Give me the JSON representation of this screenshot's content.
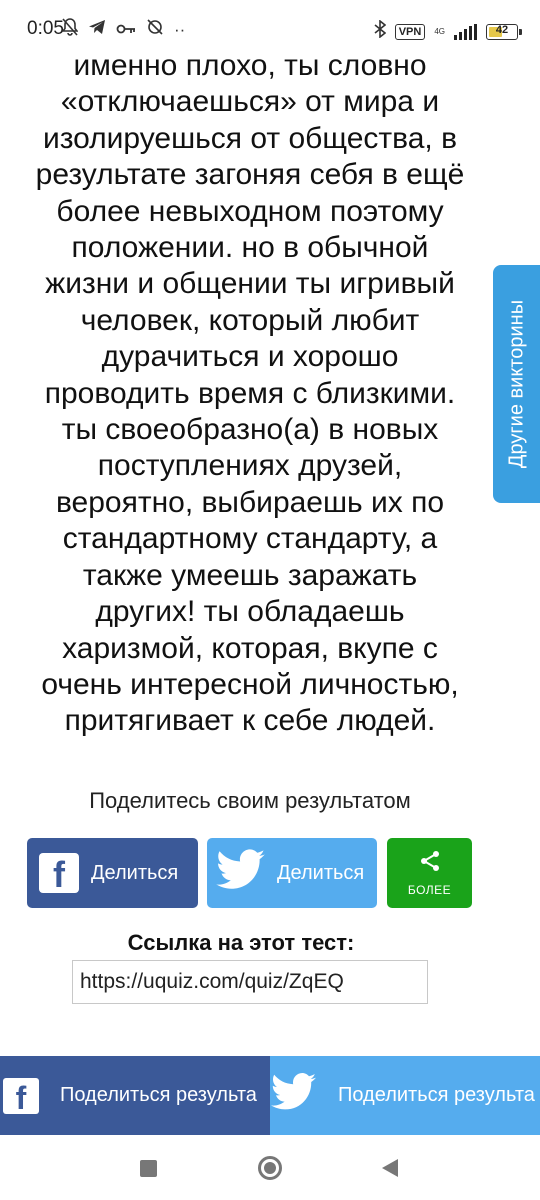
{
  "status_bar": {
    "time": "0:05",
    "vpn": "VPN",
    "network": "4G",
    "battery": "42"
  },
  "result": {
    "lines": [
      "именно плохо, ты словно",
      "«отключаешься» от мира и",
      "изолируешься от общества, в",
      "результате загоняя себя в ещё",
      "более невыходном поэтому",
      "положении. но в обычной",
      "жизни и общении ты игривый",
      "человек, который любит",
      "дурачиться и хорошо",
      "проводить время с близкими.",
      "ты своеобразно(а) в новых",
      "поступлениях друзей,",
      "вероятно, выбираешь их по",
      "стандартному стандарту, а",
      "также умеешь заражать",
      "других! ты обладаешь",
      "харизмой, которая, вкупе с",
      "очень интересной личностью,",
      "притягивает к себе людей."
    ]
  },
  "side_tab": {
    "label": "Другие викторины"
  },
  "share": {
    "heading": "Поделитесь своим результатом",
    "facebook_label": "Делиться",
    "twitter_label": "Делиться",
    "more_label": "БОЛЕЕ"
  },
  "link": {
    "label": "Ссылка на этот тест:",
    "value": "https://uquiz.com/quiz/ZqEQ"
  },
  "bottom_share": {
    "facebook_label": "Поделиться результа",
    "twitter_label": "Поделиться результа"
  },
  "colors": {
    "facebook": "#3b5998",
    "twitter": "#55acee",
    "more": "#1aa31a",
    "side_tab": "#3a9fe0"
  }
}
